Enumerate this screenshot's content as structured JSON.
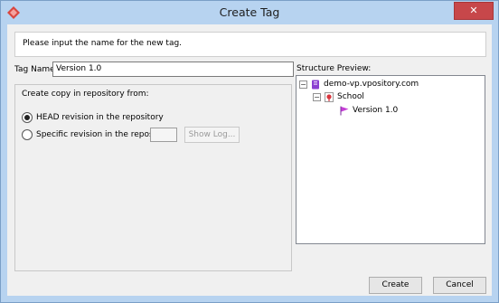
{
  "window": {
    "title": "Create Tag",
    "close_label": "✕",
    "title_bar_color": "#b7d3f0"
  },
  "header": {
    "text": "Please input the name for the new tag."
  },
  "form": {
    "tag_name_label": "Tag Name:",
    "tag_name_value": "Version 1.0"
  },
  "copy_group": {
    "title": "Create copy in repository from:",
    "options": [
      {
        "label": "HEAD revision in the repository",
        "selected": true
      },
      {
        "label": "Specific revision in the repository",
        "selected": false
      }
    ],
    "revision_value": "",
    "show_log_label": "Show Log..."
  },
  "preview": {
    "label": "Structure Preview:",
    "tree": [
      {
        "label": "demo-vp.vpository.com",
        "icon": "repository-icon",
        "expander": "−"
      },
      {
        "label": "School",
        "icon": "project-icon",
        "expander": "−"
      },
      {
        "label": "Version 1.0",
        "icon": "tag-flag-icon"
      }
    ]
  },
  "buttons": {
    "create_label": "Create",
    "cancel_label": "Cancel"
  }
}
